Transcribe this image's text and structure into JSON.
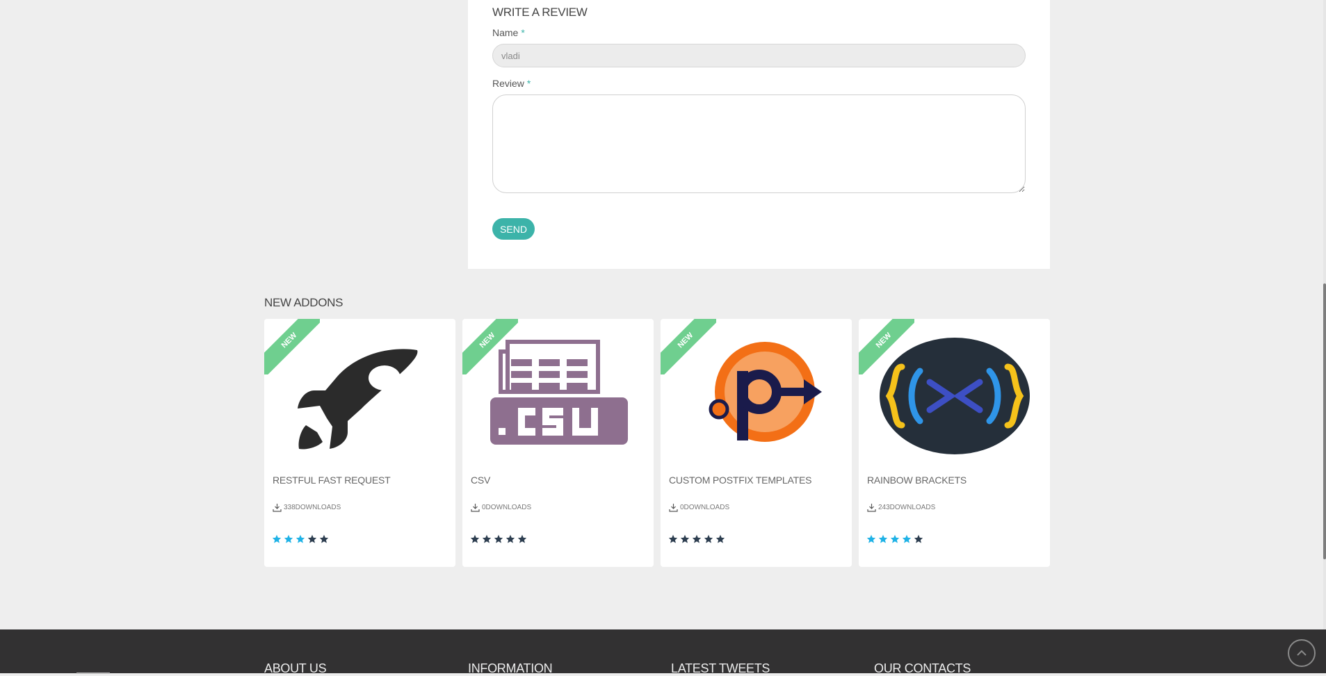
{
  "review_form": {
    "title": "WRITE A REVIEW",
    "name_label": "Name",
    "name_required": "*",
    "name_value": "vladi",
    "review_label": "Review",
    "review_required": "*",
    "review_value": "",
    "send_label": "SEND"
  },
  "new_addons": {
    "title": "NEW ADDONS",
    "ribbon_label": "NEW",
    "items": [
      {
        "title": "RESTFUL FAST REQUEST",
        "downloads": "338DOWNLOADS",
        "rating": 3,
        "icon": "rocket-icon"
      },
      {
        "title": "CSV",
        "downloads": "0DOWNLOADS",
        "rating": 0,
        "icon": "csv-file-icon"
      },
      {
        "title": "CUSTOM POSTFIX TEMPLATES",
        "downloads": "0DOWNLOADS",
        "rating": 0,
        "icon": "postfix-p-arrow-icon"
      },
      {
        "title": "RAINBOW BRACKETS",
        "downloads": "243DOWNLOADS",
        "rating": 4,
        "icon": "rainbow-brackets-icon"
      }
    ]
  },
  "footer": {
    "about": "ABOUT US",
    "information": "INFORMATION",
    "tweets": "LATEST TWEETS",
    "contacts": "OUR CONTACTS"
  },
  "colors": {
    "accent": "#3cb3a9",
    "ribbon": "#6fcf8f",
    "star_active": "#1fb2e6",
    "star_inactive": "#2d3e50",
    "footer_bg": "#323132"
  }
}
